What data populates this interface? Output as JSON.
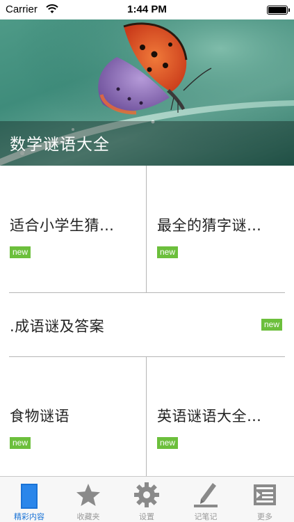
{
  "status_bar": {
    "carrier": "Carrier",
    "time": "1:44 PM",
    "battery_level": 1.0
  },
  "banner": {
    "title": "数学谜语大全"
  },
  "items": [
    {
      "title": "适合小学生猜…",
      "badge": "new"
    },
    {
      "title": "最全的猜字谜…",
      "badge": "new"
    },
    {
      "title": ".成语谜及答案",
      "badge": "new"
    },
    {
      "title": "食物谜语",
      "badge": "new"
    },
    {
      "title": "英语谜语大全…",
      "badge": "new"
    }
  ],
  "tabs": [
    {
      "label": "精彩内容",
      "icon": "bookmark-icon",
      "active": true
    },
    {
      "label": "收藏夹",
      "icon": "star-icon",
      "active": false
    },
    {
      "label": "设置",
      "icon": "gear-icon",
      "active": false
    },
    {
      "label": "记笔记",
      "icon": "pencil-icon",
      "active": false
    },
    {
      "label": "更多",
      "icon": "list-icon",
      "active": false
    }
  ],
  "colors": {
    "accent": "#1a73d6",
    "badge": "#6cbf3c",
    "inactive_tab": "#999999"
  }
}
